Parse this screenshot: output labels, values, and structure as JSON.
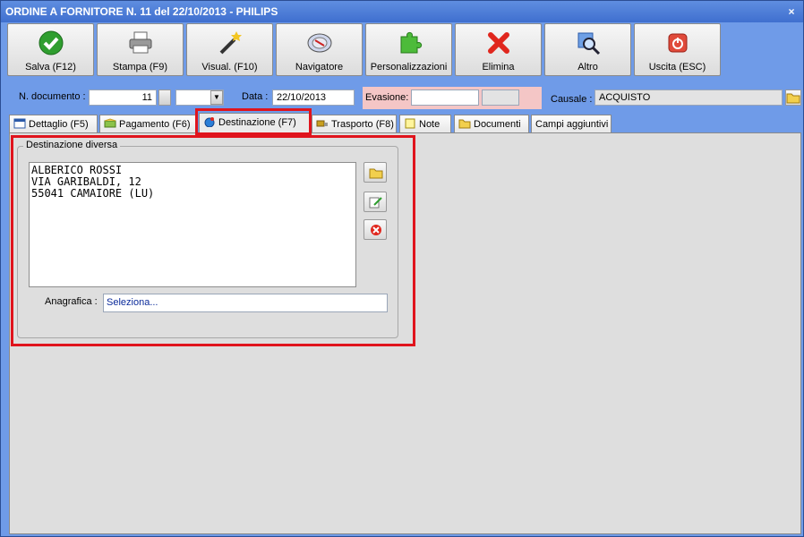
{
  "window": {
    "title": "ORDINE A FORNITORE N. 11 del 22/10/2013 - PHILIPS",
    "close": "×"
  },
  "toolbar": {
    "buttons": [
      {
        "label": "Salva (F12)",
        "icon": "check-icon"
      },
      {
        "label": "Stampa (F9)",
        "icon": "printer-icon"
      },
      {
        "label": "Visual. (F10)",
        "icon": "magic-wand-icon"
      },
      {
        "label": "Navigatore",
        "icon": "compass-icon"
      },
      {
        "label": "Personalizzazioni",
        "icon": "puzzle-icon"
      },
      {
        "label": "Elimina",
        "icon": "delete-x-icon"
      },
      {
        "label": "Altro",
        "icon": "magnifier-icon"
      },
      {
        "label": "Uscita (ESC)",
        "icon": "power-icon"
      }
    ]
  },
  "fields": {
    "doc_label": "N. documento :",
    "doc_number": "11",
    "data_label": "Data :",
    "data_value": "22/10/2013",
    "evasione_label": "Evasione:",
    "evasione_value": "",
    "causale_label": "Causale :",
    "causale_value": "ACQUISTO"
  },
  "tabs": [
    {
      "label": "Dettaglio (F5)",
      "icon": "calendar-icon"
    },
    {
      "label": "Pagamento (F6)",
      "icon": "money-icon"
    },
    {
      "label": "Destinazione (F7)",
      "icon": "globe-icon",
      "active": true
    },
    {
      "label": "Trasporto (F8)",
      "icon": "truck-icon"
    },
    {
      "label": "Note",
      "icon": "note-icon"
    },
    {
      "label": "Documenti",
      "icon": "folder-icon"
    },
    {
      "label": "Campi aggiuntivi",
      "icon": ""
    }
  ],
  "destinazione": {
    "group_title": "Destinazione diversa",
    "address": "ALBERICO ROSSI\nVIA GARIBALDI, 12\n55041 CAMAIORE (LU)",
    "anagrafica_label": "Anagrafica :",
    "anagrafica_value": "Seleziona..."
  },
  "colors": {
    "highlight": "#e0141d",
    "evasione_bg": "#f4c6c6",
    "window_bg": "#6f9be8"
  }
}
